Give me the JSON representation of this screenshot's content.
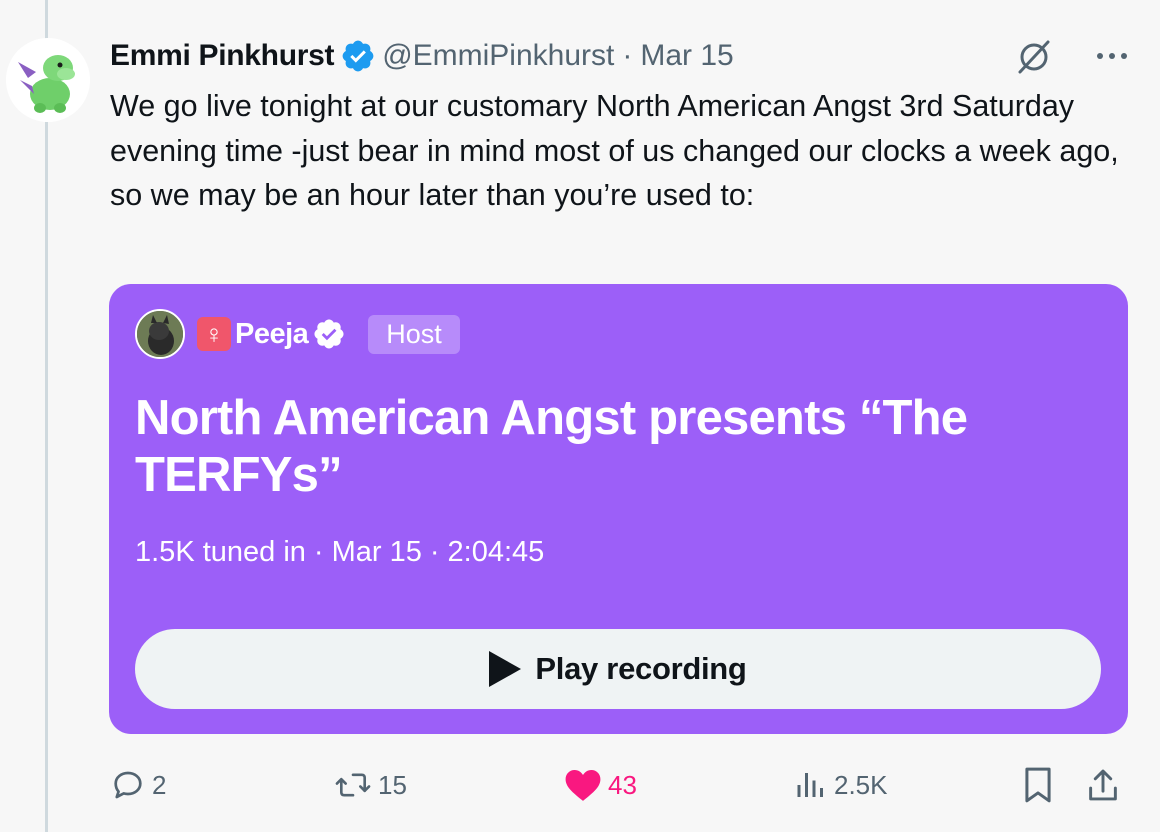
{
  "author": {
    "display_name": "Emmi Pinkhurst",
    "handle": "@EmmiPinkhurst",
    "separator": "·",
    "date": "Mar 15"
  },
  "tweet": {
    "text": "We go live tonight at our customary North American Angst 3rd Saturday evening time -just bear in mind most of us changed our clocks a week ago, so we may be an hour later than you’re used to:"
  },
  "space": {
    "host_badge": "♀",
    "host_name": "Peeja",
    "host_tag": "Host",
    "title": "North American Angst presents “The TERFYs”",
    "listeners": "1.5K tuned in",
    "sep1": "·",
    "date": "Mar 15",
    "sep2": "·",
    "duration": "2:04:45",
    "play_label": "Play recording"
  },
  "actions": {
    "replies": "2",
    "reposts": "15",
    "likes": "43",
    "views": "2.5K"
  },
  "icons": {
    "verified": "verified-badge-icon",
    "grok": "grok-icon",
    "more": "more-icon",
    "reply": "reply-icon",
    "repost": "repost-icon",
    "like": "heart-icon",
    "views": "views-icon",
    "bookmark": "bookmark-icon",
    "share": "share-icon"
  },
  "colors": {
    "card_background": "#9c5ff8",
    "verified_blue": "#1d9bf0",
    "like_pink": "#f91880",
    "muted_text": "#536471"
  }
}
